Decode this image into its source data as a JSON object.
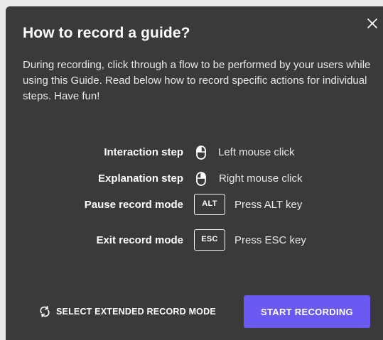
{
  "dialog": {
    "title": "How to record a guide?",
    "intro": "During recording, click through a flow to be performed by your users while using this Guide. Read below how to record specific actions for individual steps. Have fun!",
    "close_icon": "close-icon"
  },
  "steps": [
    {
      "label": "Interaction step",
      "icon": "mouse-left-click-icon",
      "description": "Left mouse click"
    },
    {
      "label": "Explanation step",
      "icon": "mouse-right-click-icon",
      "description": "Right mouse click"
    },
    {
      "label": "Pause record mode",
      "key": "ALT",
      "description": "Press ALT key"
    },
    {
      "label": "Exit record mode",
      "key": "ESC",
      "description": "Press ESC key"
    }
  ],
  "footer": {
    "extended_mode_label": "SELECT EXTENDED RECORD MODE",
    "extended_mode_icon": "refresh-icon",
    "start_button_label": "START RECORDING"
  },
  "colors": {
    "dialog_background": "#3a3a3a",
    "accent": "#6a5af1",
    "text": "#ffffff"
  }
}
